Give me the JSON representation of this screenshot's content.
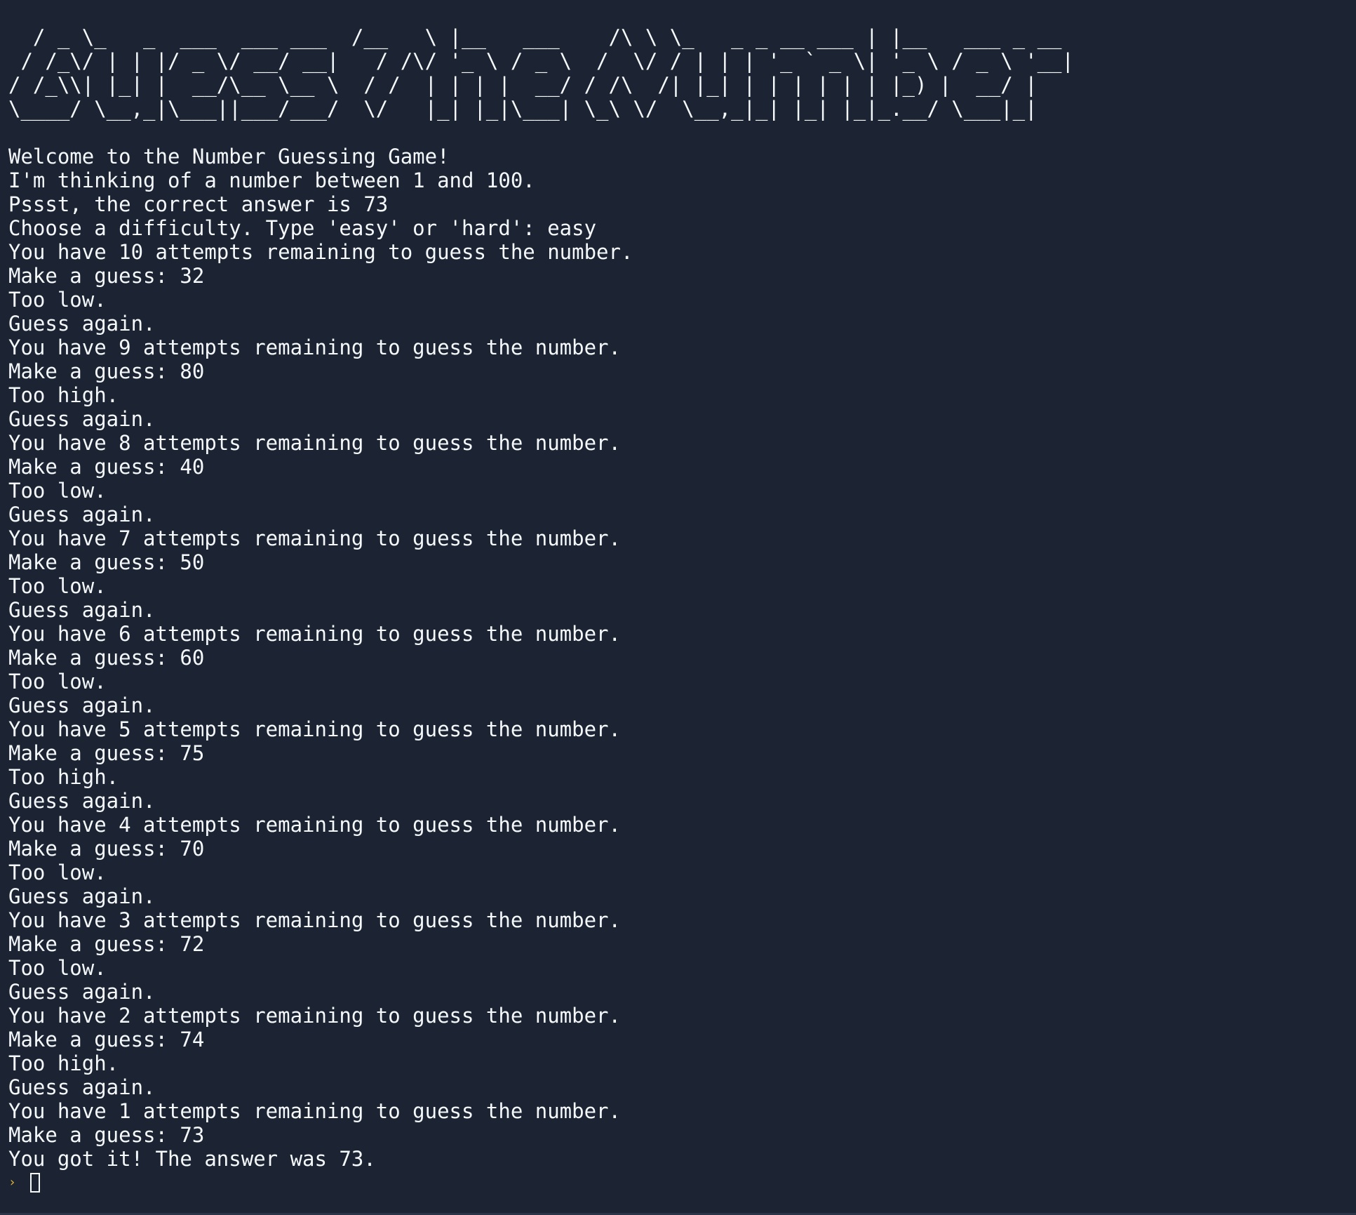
{
  "banner": [
    "  / _ \\_   _  ___  ___ ___  /__   \\ |__   ___    /\\ \\ \\_   _ _ __ ___ | |__   ___ _ __",
    " / /_\\/ | | |/ _ \\/ __/ __|   / /\\/ '_ \\ / _ \\  /  \\/ / | | | '_ ` _ \\| '_ \\ / _ \\ '__|",
    "/ /_\\\\| |_| |  __/\\__ \\__ \\  / /  | | | |  __/ / /\\  /| |_| | | | | | | |_) |  __/ |",
    "\\____/ \\__,_|\\___||___/___/  \\/   |_| |_|\\___| \\_\\ \\/  \\__,_|_| |_| |_|_.__/ \\___|_|"
  ],
  "lines": [
    "Welcome to the Number Guessing Game!",
    "I'm thinking of a number between 1 and 100.",
    "Pssst, the correct answer is 73",
    "Choose a difficulty. Type 'easy' or 'hard': easy",
    "You have 10 attempts remaining to guess the number.",
    "Make a guess: 32",
    "Too low.",
    "Guess again.",
    "You have 9 attempts remaining to guess the number.",
    "Make a guess: 80",
    "Too high.",
    "Guess again.",
    "You have 8 attempts remaining to guess the number.",
    "Make a guess: 40",
    "Too low.",
    "Guess again.",
    "You have 7 attempts remaining to guess the number.",
    "Make a guess: 50",
    "Too low.",
    "Guess again.",
    "You have 6 attempts remaining to guess the number.",
    "Make a guess: 60",
    "Too low.",
    "Guess again.",
    "You have 5 attempts remaining to guess the number.",
    "Make a guess: 75",
    "Too high.",
    "Guess again.",
    "You have 4 attempts remaining to guess the number.",
    "Make a guess: 70",
    "Too low.",
    "Guess again.",
    "You have 3 attempts remaining to guess the number.",
    "Make a guess: 72",
    "Too low.",
    "Guess again.",
    "You have 2 attempts remaining to guess the number.",
    "Make a guess: 74",
    "Too high.",
    "Guess again.",
    "You have 1 attempts remaining to guess the number.",
    "Make a guess: 73",
    "You got it! The answer was 73."
  ],
  "prompt": {
    "symbol": "›",
    "icon": "chevron-right-icon",
    "color": "#e0b636"
  },
  "colors": {
    "background": "#1c2333",
    "text": "#f5f9fc"
  }
}
